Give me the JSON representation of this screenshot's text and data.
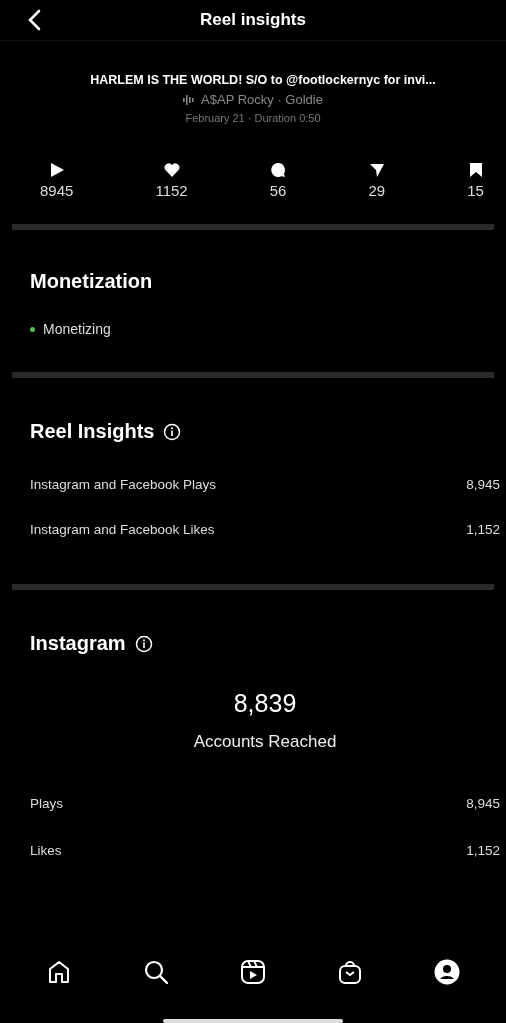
{
  "header": {
    "title": "Reel insights"
  },
  "reel": {
    "caption": "HARLEM IS THE WORLD! S/O to @footlockernyc for invi...",
    "audio": "A$AP Rocky · Goldie",
    "meta": "February 21 · Duration 0:50"
  },
  "stats": [
    {
      "kind": "play",
      "value": "8945"
    },
    {
      "kind": "like",
      "value": "1152"
    },
    {
      "kind": "comment",
      "value": "56"
    },
    {
      "kind": "share",
      "value": "29"
    },
    {
      "kind": "save",
      "value": "15"
    }
  ],
  "monetization": {
    "title": "Monetization",
    "status": "Monetizing",
    "color": "#4cc552"
  },
  "reel_insights": {
    "title": "Reel Insights",
    "rows": [
      {
        "label": "Instagram and Facebook Plays",
        "value": "8,945"
      },
      {
        "label": "Instagram and Facebook Likes",
        "value": "1,152"
      }
    ]
  },
  "instagram": {
    "title": "Instagram",
    "reached": "8,839",
    "reached_label": "Accounts Reached",
    "rows": [
      {
        "label": "Plays",
        "value": "8,945"
      },
      {
        "label": "Likes",
        "value": "1,152"
      }
    ]
  },
  "nav": [
    {
      "kind": "home",
      "selected": false
    },
    {
      "kind": "search",
      "selected": false
    },
    {
      "kind": "reels",
      "selected": false
    },
    {
      "kind": "shop",
      "selected": false
    },
    {
      "kind": "profile",
      "selected": true
    }
  ]
}
